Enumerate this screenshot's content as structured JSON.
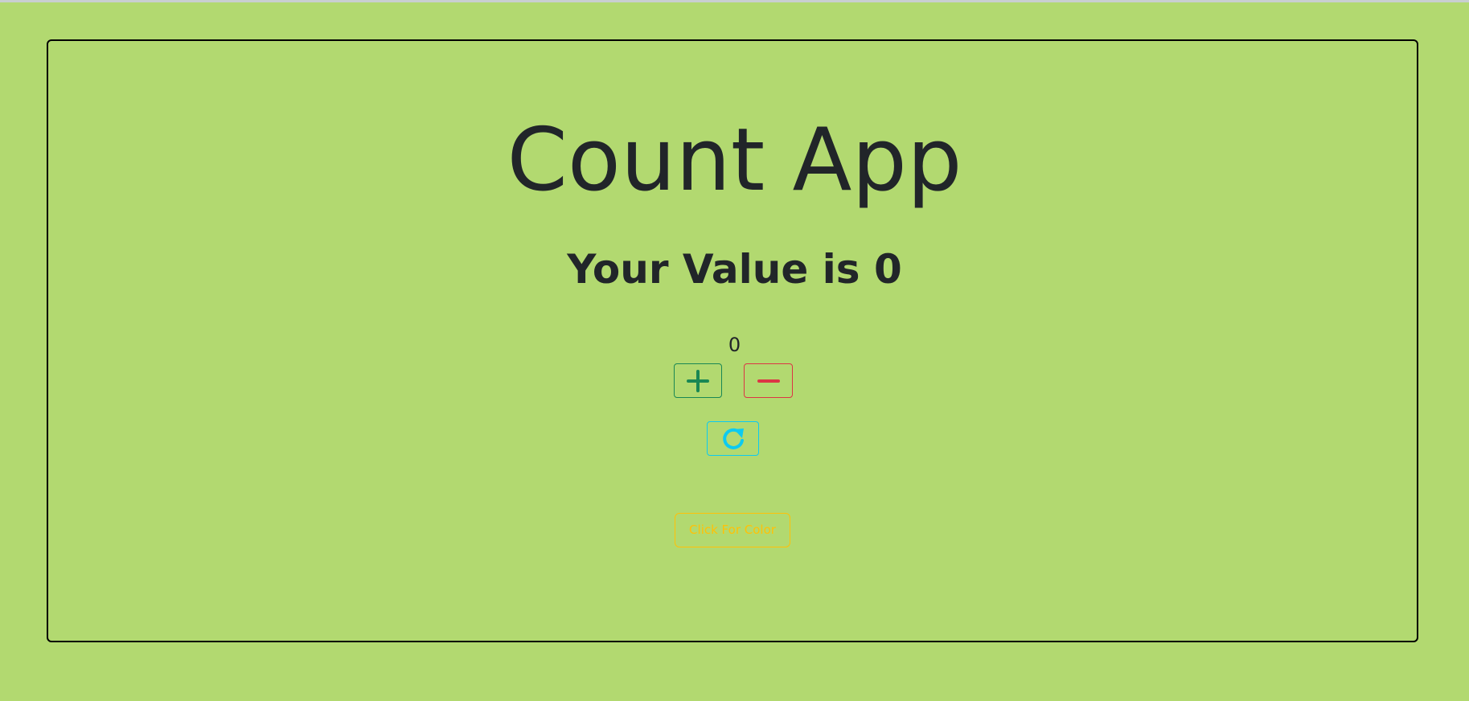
{
  "app": {
    "title": "Count App",
    "value_label": "Your Value is 0",
    "count": "0"
  },
  "controls": {
    "increment_icon": "plus-icon",
    "decrement_icon": "minus-icon",
    "reset_icon": "refresh-icon",
    "color_button_label": "Click For Color"
  },
  "colors": {
    "background": "#b2d970",
    "text": "#212529",
    "increment": "#198754",
    "decrement": "#dc3545",
    "reset": "#0dcaf0",
    "color_button": "#ffc107"
  }
}
